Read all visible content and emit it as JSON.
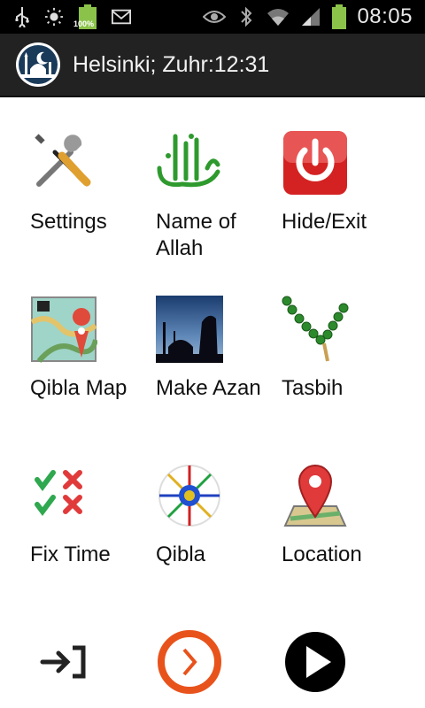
{
  "status_bar": {
    "left_icons": [
      "usb-icon",
      "brightness-icon",
      "battery-full-icon",
      "gmail-icon"
    ],
    "battery_small_label": "100%",
    "right_icons": [
      "eye-icon",
      "bluetooth-icon",
      "wifi-icon",
      "signal-icon",
      "battery-icon"
    ],
    "time": "08:05",
    "accent": "#8bc34a"
  },
  "app_bar": {
    "title": "Helsinki; Zuhr:12:31",
    "logo_icon": "mosque-icon"
  },
  "menu": {
    "items": [
      {
        "label": "Settings",
        "icon": "tools-icon"
      },
      {
        "label": "Name of Allah",
        "icon": "allah-calligraphy-icon"
      },
      {
        "label": "Hide/Exit",
        "icon": "power-icon"
      },
      {
        "label": "Qibla Map",
        "icon": "qibla-map-icon"
      },
      {
        "label": "Make Azan",
        "icon": "mosque-silhouette-icon"
      },
      {
        "label": "Tasbih",
        "icon": "prayer-beads-icon"
      },
      {
        "label": "Fix Time",
        "icon": "check-cross-icon"
      },
      {
        "label": "Qibla",
        "icon": "compass-icon"
      },
      {
        "label": "Location",
        "icon": "location-pin-icon"
      },
      {
        "label": "",
        "icon": "sign-in-icon"
      },
      {
        "label": "",
        "icon": "orange-arrow-icon"
      },
      {
        "label": "",
        "icon": "play-icon"
      }
    ]
  }
}
